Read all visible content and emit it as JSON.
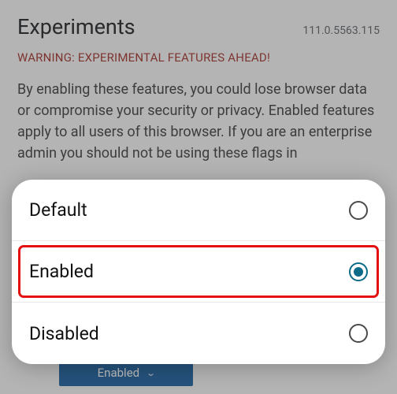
{
  "header": {
    "title": "Experiments",
    "version": "111.0.5563.115"
  },
  "warning": "WARNING: EXPERIMENTAL FEATURES AHEAD!",
  "body": "By enabling these features, you could lose browser data or compromise your security or privacy. Enabled features apply to all users of this browser. If you are an enterprise admin you should not be using these flags in",
  "dropdown": {
    "value": "Enabled"
  },
  "options": [
    {
      "label": "Default",
      "selected": false,
      "highlighted": false
    },
    {
      "label": "Enabled",
      "selected": true,
      "highlighted": true
    },
    {
      "label": "Disabled",
      "selected": false,
      "highlighted": false
    }
  ]
}
